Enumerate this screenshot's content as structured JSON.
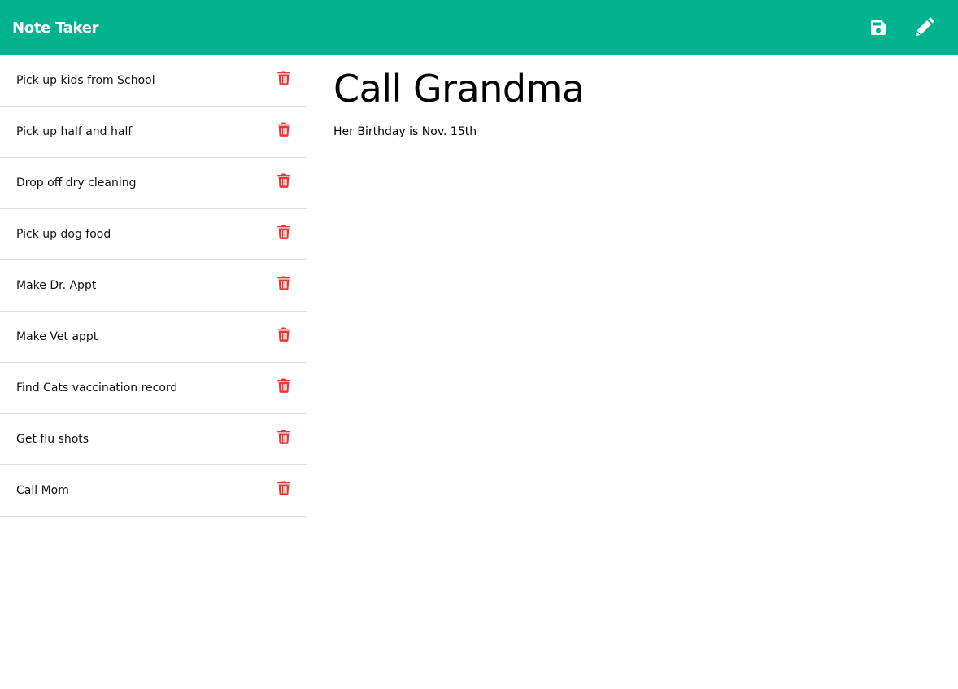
{
  "app": {
    "brand": "Note Taker"
  },
  "toolbar": {
    "save_icon": "floppy-disk-icon",
    "new_icon": "pencil-icon"
  },
  "notes": [
    {
      "title": "Pick up kids from School"
    },
    {
      "title": "Pick up half and half"
    },
    {
      "title": "Drop off dry cleaning"
    },
    {
      "title": "Pick up dog food"
    },
    {
      "title": "Make Dr. Appt"
    },
    {
      "title": "Make Vet appt"
    },
    {
      "title": "Find Cats vaccination record"
    },
    {
      "title": "Get flu shots"
    },
    {
      "title": "Call Mom"
    }
  ],
  "active_note": {
    "title": "Call Grandma",
    "text": "Her Birthday is Nov. 15th"
  },
  "colors": {
    "navbar": "#00b290",
    "delete": "#e53935"
  }
}
